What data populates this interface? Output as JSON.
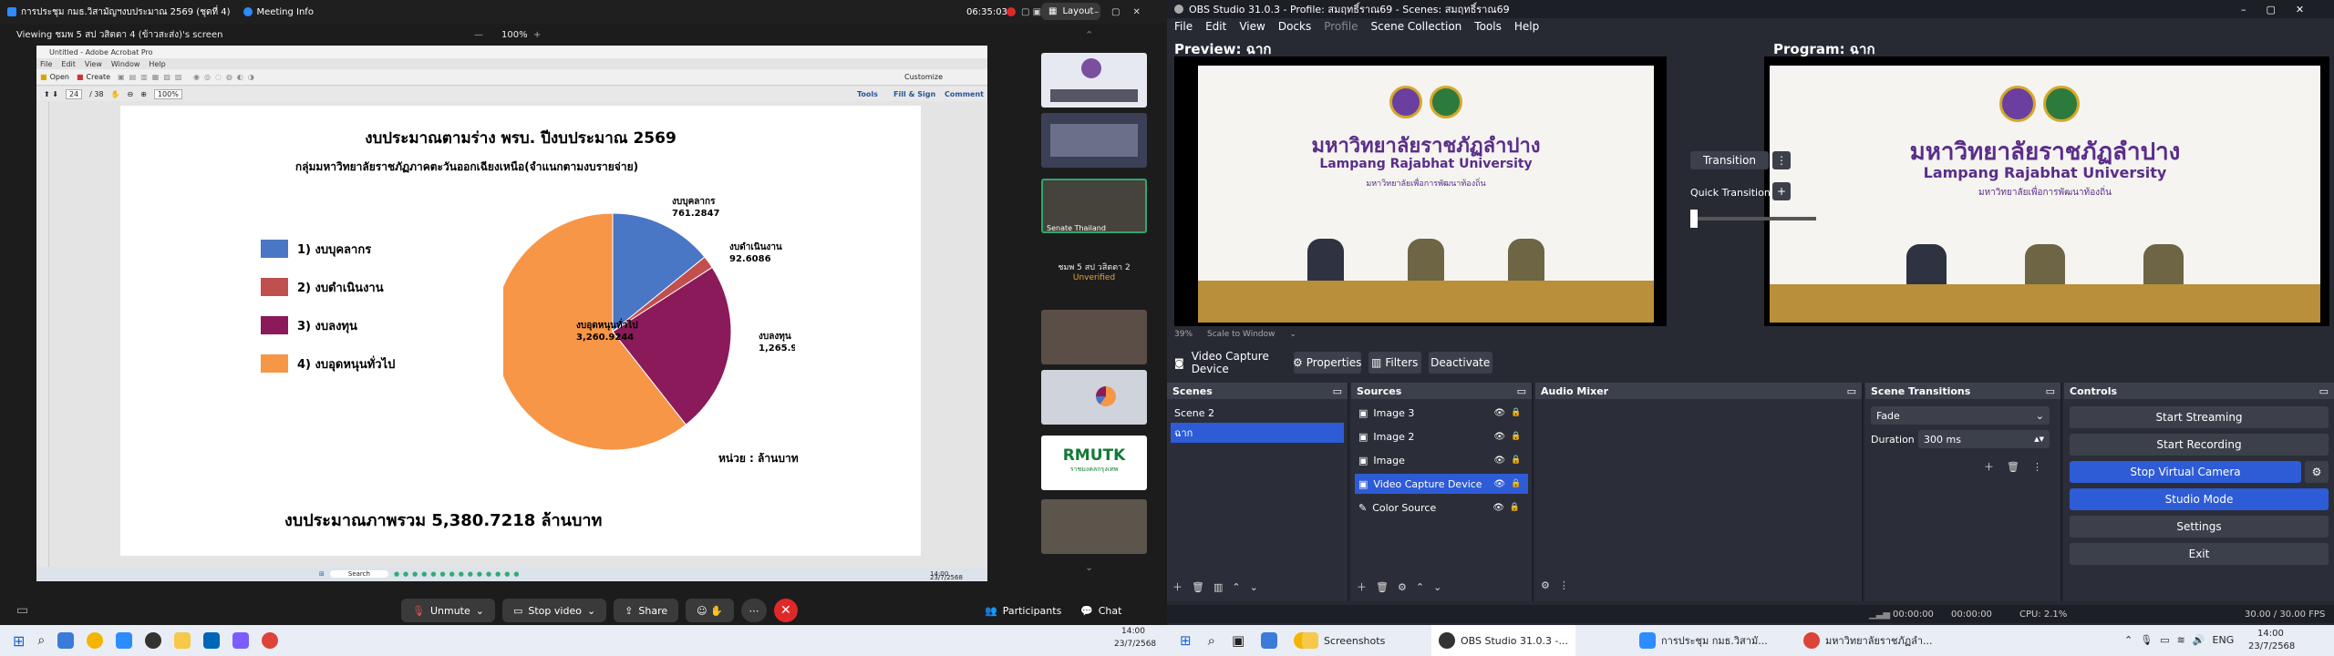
{
  "zoom": {
    "tab1": "การประชุม กมธ.วิสามัญฯงบประมาณ 2569 (ชุดที่ 4)",
    "tab2": "Meeting Info",
    "time": "06:35:03",
    "layout": "Layout",
    "viewing": "Viewing ชมพ 5 สป วสิตตา 4 (ข้าวสะส่ง)'s screen",
    "zoom_level": "100%",
    "mute": "Unmute",
    "stop_video": "Stop video",
    "share": "Share",
    "participants": "Participants",
    "chat": "Chat",
    "thumb_label3": "Senate Thailand",
    "thumb_name": "ชมพ 5 สป วสิตตา 2",
    "thumb_status": "Unverified",
    "thumb_logo": "RMUTK",
    "thumb_logo_sub": "ราชมงคลกรุงเทพ"
  },
  "pdf": {
    "app_title": "Untitled - Adobe Acrobat Pro",
    "menu": [
      "File",
      "Edit",
      "View",
      "Window",
      "Help"
    ],
    "open": "Open",
    "create": "Create",
    "customize": "Customize",
    "tools": "Tools",
    "fillsign": "Fill & Sign",
    "comment": "Comment",
    "page": "24",
    "pages": "/ 38",
    "zoom": "100%",
    "title": "งบประมาณตามร่าง พรบ. ปีงบประมาณ 2569",
    "subtitle": "กลุ่มมหาวิทยาลัยราชภัฏภาคตะวันออกเฉียงเหนือ(จำแนกตามงบรายจ่าย)",
    "unit": "หน่วย : ล้านบาท",
    "total": "งบประมาณภาพรวม  5,380.7218  ล้านบาท",
    "search": "Search",
    "clock": "14:00",
    "date": "23/7/2568"
  },
  "chart_data": {
    "type": "pie",
    "title": "งบประมาณตามร่าง พรบ. ปีงบประมาณ 2569",
    "categories": [
      "1) งบบุคลากร",
      "2) งบดำเนินงาน",
      "3) งบลงทุน",
      "4) งบอุดหนุนทั่วไป"
    ],
    "slice_labels": [
      "งบบุคลากร",
      "งบดำเนินงาน",
      "งบลงทุน",
      "งบอุดหนุนทั่วไป"
    ],
    "values": [
      761.2847,
      92.6086,
      1265.9041,
      3260.9244
    ],
    "value_labels": [
      "761.2847",
      "92.6086",
      "1,265.9041",
      "3,260.9244"
    ],
    "colors": [
      "#4a76c6",
      "#c0504d",
      "#8b1a5a",
      "#f79646"
    ],
    "legend": "left"
  },
  "obs": {
    "title": "OBS Studio 31.0.3 - Profile: สมฤทธิ์ราณ69 - Scenes: สมฤทธิ์ราณ69",
    "menu": [
      "File",
      "Edit",
      "View",
      "Docks",
      "Profile",
      "Scene Collection",
      "Tools",
      "Help"
    ],
    "preview": "Preview: ฉาก",
    "program": "Program: ฉาก",
    "transition": "Transition",
    "quick": "Quick Transitions",
    "scale": "39%",
    "scale_label": "Scale to Window",
    "vcd": "Video Capture Device",
    "properties": "Properties",
    "filters": "Filters",
    "deactivate": "Deactivate",
    "scenes_h": "Scenes",
    "sources_h": "Sources",
    "mixer_h": "Audio Mixer",
    "trans_h": "Scene Transitions",
    "controls_h": "Controls",
    "scenes": [
      "Scene 2",
      "ฉาก"
    ],
    "sources": [
      "Image 3",
      "Image 2",
      "Image",
      "Video Capture Device",
      "Color Source"
    ],
    "fade": "Fade",
    "duration_l": "Duration",
    "duration": "300 ms",
    "controls": [
      "Start Streaming",
      "Start Recording",
      "Stop Virtual Camera",
      "Studio Mode",
      "Settings",
      "Exit"
    ],
    "status_t1": "00:00:00",
    "status_t2": "00:00:00",
    "cpu": "CPU: 2.1%",
    "fps": "30.00 / 30.00 FPS",
    "uni_th": "มหาวิทยาลัยราชภัฏลำปาง",
    "uni_en": "Lampang Rajabhat University",
    "uni_sub": "มหาวิทยาลัยเพื่อการพัฒนาท้องถิ่น"
  },
  "win": {
    "screenshots": "Screenshots",
    "obs": "OBS Studio 31.0.3 -...",
    "zoom": "การประชุม กมธ.วิสามั...",
    "browser": "มหาวิทยาลัยราชภัฏลำ...",
    "lang": "ENG",
    "clock": "14:00",
    "date": "23/7/2568"
  }
}
